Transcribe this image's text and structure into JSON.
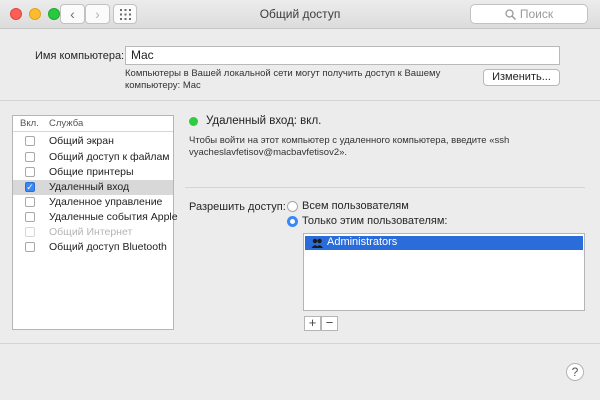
{
  "window": {
    "title": "Общий доступ",
    "search_placeholder": "Поиск",
    "colors": {
      "close": "#fc5f57",
      "minimize": "#fdbc2e",
      "zoom": "#28c840"
    }
  },
  "computer": {
    "name_label": "Имя компьютера:",
    "name_value": "Mac",
    "description": "Компьютеры в Вашей локальной сети могут получить доступ к Вашему компьютеру: Mac",
    "edit_button": "Изменить..."
  },
  "services": {
    "header_on": "Вкл.",
    "header_service": "Служба",
    "items": [
      {
        "label": "Общий экран",
        "checked": false
      },
      {
        "label": "Общий доступ к файлам",
        "checked": false
      },
      {
        "label": "Общие принтеры",
        "checked": false
      },
      {
        "label": "Удаленный вход",
        "checked": true,
        "selected": true
      },
      {
        "label": "Удаленное управление",
        "checked": false
      },
      {
        "label": "Удаленные события Apple",
        "checked": false
      },
      {
        "label": "Общий Интернет",
        "checked": false,
        "disabled": true
      },
      {
        "label": "Общий доступ Bluetooth",
        "checked": false
      }
    ]
  },
  "detail": {
    "status": "Удаленный вход: вкл.",
    "status_color": "#2ecc40",
    "info": "Чтобы войти на этот компьютер с удаленного компьютера, введите «ssh vyacheslavfetisov@macbavfetisov2».",
    "access_label": "Разрешить доступ:",
    "option_all": "Всем пользователям",
    "option_only": "Только этим пользователям:",
    "selected_option": "only",
    "users": [
      "Administrators"
    ],
    "add_button": "+",
    "remove_button": "−"
  },
  "help_button": "?"
}
